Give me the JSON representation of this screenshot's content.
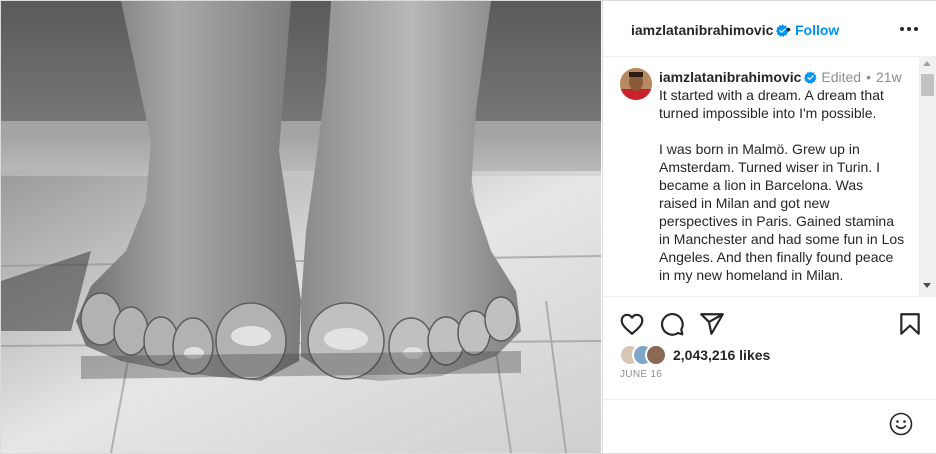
{
  "header": {
    "username": "iamzlatanibrahimovic",
    "follow_label": "Follow"
  },
  "caption": {
    "username": "iamzlatanibrahimovic",
    "edited_label": "Edited",
    "time_ago": "21w",
    "paragraphs": [
      "It started with a dream. A dream that turned impossible into I'm possible.",
      "I was born in Malmö. Grew up in Amsterdam. Turned wiser in Turin. I became a lion in Barcelona. Was raised in Milan and got new perspectives in Paris. Gained stamina in Manchester and had some fun in Los Angeles. And then finally found peace in my new homeland in Milan."
    ]
  },
  "likes": {
    "count_label": "2,043,216 likes"
  },
  "date_label": "JUNE 16",
  "icons": {
    "like": "heart-icon",
    "comment": "comment-icon",
    "share": "share-icon",
    "save": "bookmark-icon",
    "emoji": "emoji-icon",
    "more": "more-options-icon",
    "verified": "verified-badge-icon"
  },
  "colors": {
    "link": "#0095f6",
    "verified": "#0095f6",
    "text": "#262626",
    "secondary": "#8e8e8e"
  }
}
